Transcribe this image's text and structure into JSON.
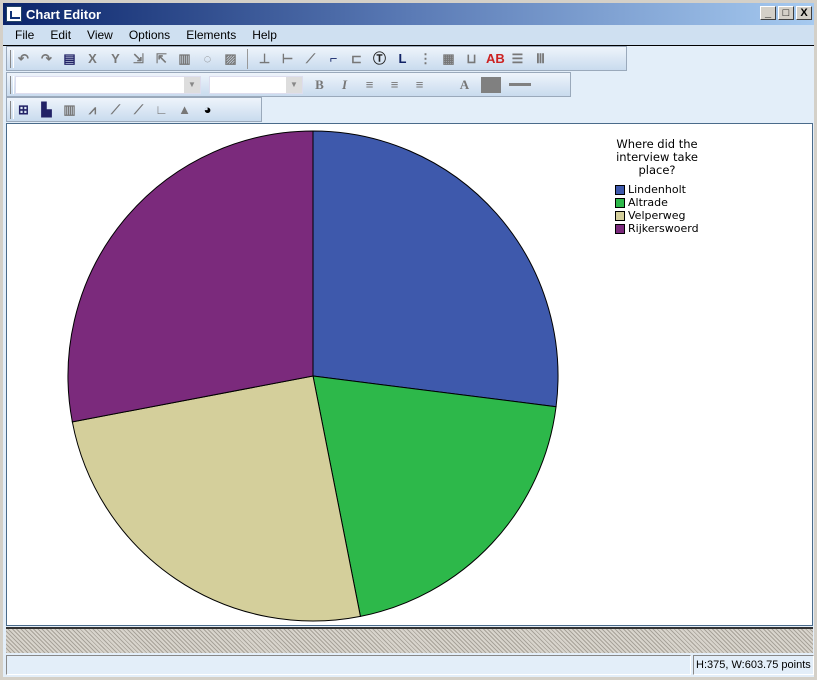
{
  "window": {
    "title": "Chart Editor",
    "minimize": "_",
    "maximize": "□",
    "close": "X"
  },
  "menu": [
    "File",
    "Edit",
    "View",
    "Options",
    "Elements",
    "Help"
  ],
  "toolbar_format": {
    "bold": "B",
    "italic": "I",
    "text_color": "A"
  },
  "chart_data": {
    "type": "pie",
    "legend_title": "Where did the interview take place?",
    "legend_position": "top-right",
    "categories": [
      "Lindenholt",
      "Altrade",
      "Velperweg",
      "Rijkerswoerd"
    ],
    "values": [
      27.0,
      19.9,
      25.1,
      28.0
    ],
    "colors": [
      "#3e59ac",
      "#2db84a",
      "#d4cf9b",
      "#7b2a7c"
    ]
  },
  "status": {
    "dimensions": "H:375, W:603.75 points"
  }
}
